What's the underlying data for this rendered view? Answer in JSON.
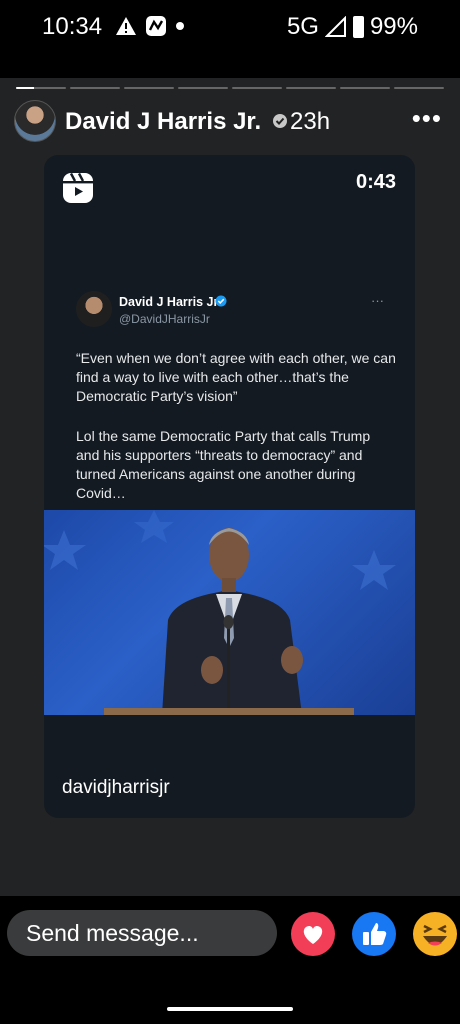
{
  "status_bar": {
    "time": "10:34",
    "network": "5G",
    "battery": "99%",
    "icons": [
      "warning-icon",
      "app-notification-icon",
      "dot-icon",
      "signal-icon",
      "battery-icon"
    ]
  },
  "story": {
    "segments_total": 8,
    "active_segment": 1,
    "active_segment_progress": 0.35,
    "author": "David J Harris Jr.",
    "age": "23h",
    "more_label": "•••"
  },
  "card": {
    "duration": "0:43",
    "tweet": {
      "name": "David J Harris Jr",
      "handle": "@DavidJHarrisJr",
      "more_label": "···",
      "paragraphs": [
        "“Even when we don’t agree with each other, we can find a way to live with each other…that’s the Democratic Party’s vision”",
        "Lol the same Democratic Party that calls Trump and his supporters “threats to democracy” and turned Americans against one another during Covid…"
      ]
    },
    "username": "davidjharrisjr"
  },
  "bottom": {
    "send_placeholder": "Send message...",
    "reactions": [
      "heart-reaction",
      "like-reaction",
      "haha-reaction"
    ]
  },
  "colors": {
    "background": "#222324",
    "card": "#131a22",
    "verified": "#1d9bf0",
    "heart": "#f33e58",
    "like": "#1877f2",
    "haha": "#f7b125"
  }
}
